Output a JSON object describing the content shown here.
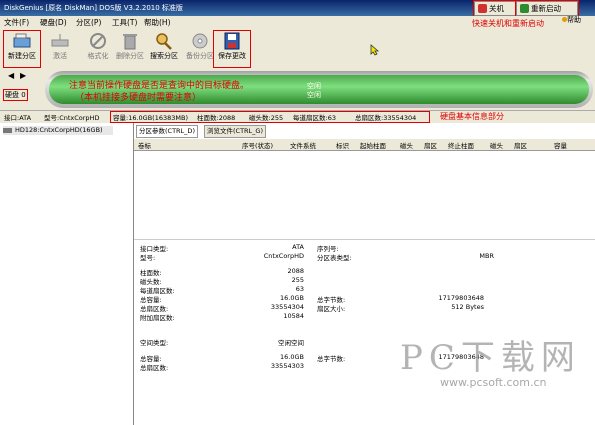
{
  "window": {
    "title": "DiskGenius [原名  DiskMan] DOS版 V3.2.2010 标准版",
    "shutdown_label": "关机",
    "restart_label": "重新启动",
    "help_label": "帮助"
  },
  "menu": [
    "文件(F)",
    "硬盘(D)",
    "分区(P)",
    "工具(T)",
    "帮助(H)"
  ],
  "toolbar": {
    "new_partition": "新建分区",
    "activate": "激活",
    "format": "格式化",
    "delete_partition": "删除分区",
    "search_partition": "搜索分区",
    "backup_partition": "备份分区",
    "save_changes": "保存更改"
  },
  "annotations": {
    "shutdown_restart": "快速关机和重新启动",
    "disk_hint_line1": "注意当前操作硬盘是否是查询中的目标硬盘。",
    "disk_hint_line2": "（本机挂接多硬盘时需要注意）",
    "disk_info": "硬盘基本信息部分"
  },
  "disk_strip": {
    "disk_label": "硬盘 0",
    "free_label1": "空闲",
    "free_label2": "空闲"
  },
  "infoline": {
    "interface": "接口:ATA",
    "model": "型号:CntxCorpHD",
    "capacity": "容量:16.0GB(16383MB)",
    "cylinders": "柱面数:2088",
    "heads": "磁头数:255",
    "sectors_per_track": "每道扇区数:63",
    "total_sectors": "总扇区数:33554304"
  },
  "tree": {
    "item": "HD128:CntxCorpHD(16GB)"
  },
  "tabs": [
    "分区参数(CTRL_D)",
    "浏览文件(CTRL_G)"
  ],
  "columns": [
    "卷标",
    "序号(状态)",
    "文件系统",
    "标识",
    "起始柱面",
    "磁头",
    "扇区",
    "终止柱面",
    "磁头",
    "扇区",
    "容量"
  ],
  "details": {
    "interface_type_label": "接口类型:",
    "interface_type_value": "ATA",
    "model_label": "型号:",
    "model_value": "CntxCorpHD",
    "serial_label": "序列号:",
    "partition_table_label": "分区表类型:",
    "partition_table_value": "MBR",
    "cylinders_label": "柱面数:",
    "cylinders_value": "2088",
    "heads_label": "磁头数:",
    "heads_value": "255",
    "spt_label": "每道扇区数:",
    "spt_value": "63",
    "capacity_label": "总容量:",
    "capacity_value": "16.0GB",
    "total_bytes_label": "总字节数:",
    "total_bytes_value": "17179803648",
    "total_sectors_label": "总扇区数:",
    "total_sectors_value": "33554304",
    "sector_size_label": "扇区大小:",
    "sector_size_value": "512 Bytes",
    "extra_sectors_label": "附加扇区数:",
    "extra_sectors_value": "10584",
    "space_type_label": "空间类型:",
    "space_type_value": "空闲空间",
    "capacity2_label": "总容量:",
    "capacity2_value": "16.0GB",
    "total_bytes2_label": "总字节数:",
    "total_bytes2_value": "17179803648",
    "total_sectors2_label": "总扇区数:",
    "total_sectors2_value": "33554303"
  },
  "watermark": {
    "text": "PC下载网",
    "url": "www.pcsoft.com.cn"
  }
}
